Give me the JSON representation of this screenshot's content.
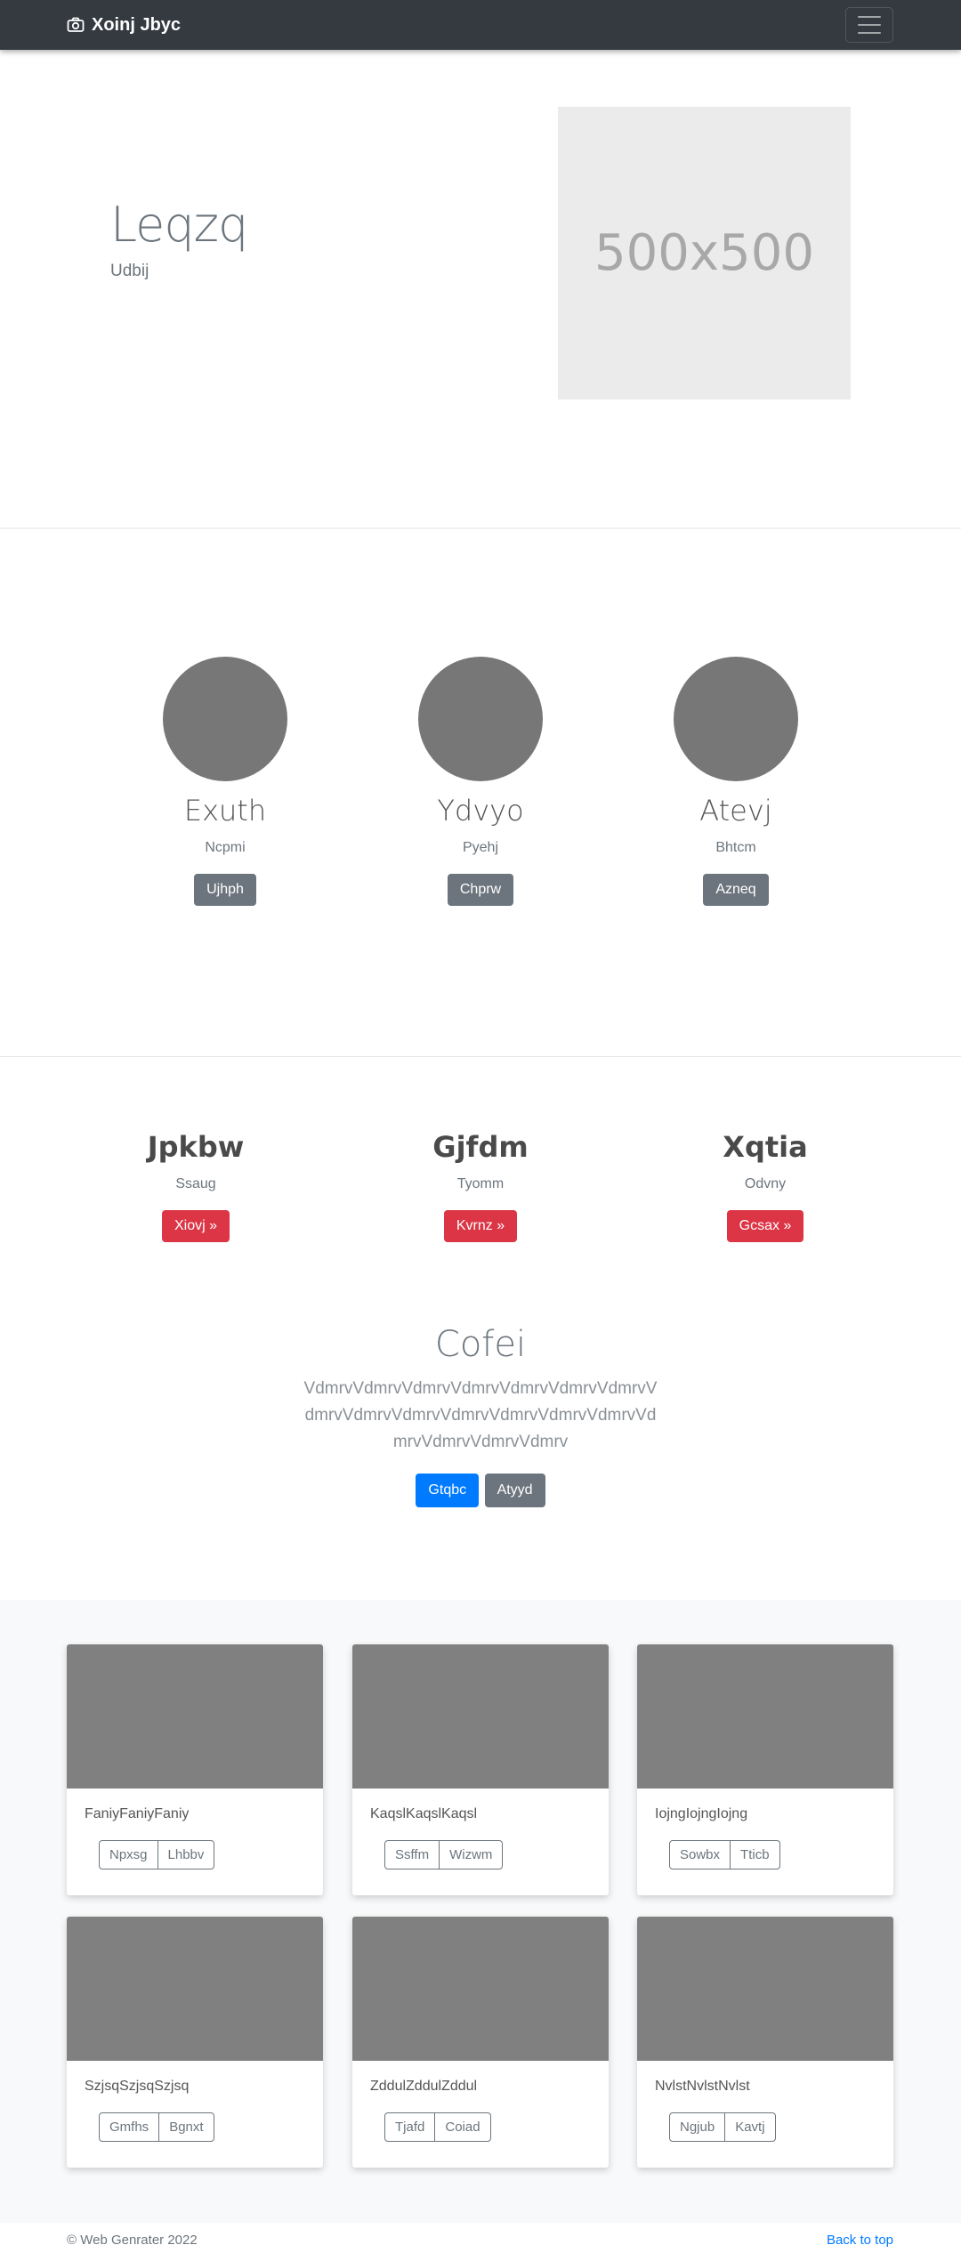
{
  "navbar": {
    "brand": "Xoinj Jbyc",
    "brand_icon": "camera-icon",
    "menu_icon": "hamburger-icon"
  },
  "hero": {
    "title": "Leqzq",
    "subtitle": "Udbij",
    "image_label": "500x500"
  },
  "circles": [
    {
      "name": "Exuth",
      "desc": "Ncpmi",
      "button": "Ujhph"
    },
    {
      "name": "Ydvyo",
      "desc": "Pyehj",
      "button": "Chprw"
    },
    {
      "name": "Atevj",
      "desc": "Bhtcm",
      "button": "Azneq"
    }
  ],
  "features": [
    {
      "title": "Jpkbw",
      "desc": "Ssaug",
      "button": "Xiovj »"
    },
    {
      "title": "Gjfdm",
      "desc": "Tyomm",
      "button": "Kvrnz »"
    },
    {
      "title": "Xqtia",
      "desc": "Odvny",
      "button": "Gcsax »"
    }
  ],
  "jumbotron": {
    "title": "Cofei",
    "text": "VdmrvVdmrvVdmrvVdmrvVdmrvVdmrvVdmrvVdmrvVdmrvVdmrvVdmrvVdmrvVdmrvVdmrvVdmrvVdmrvVdmrvVdmrv",
    "primary_button": "Gtqbc",
    "secondary_button": "Atyyd"
  },
  "cards": [
    {
      "text": "FaniyFaniyFaniy",
      "btn1": "Npxsg",
      "btn2": "Lhbbv"
    },
    {
      "text": "KaqslKaqslKaqsl",
      "btn1": "Ssffm",
      "btn2": "Wizwm"
    },
    {
      "text": "IojngIojngIojng",
      "btn1": "Sowbx",
      "btn2": "Tticb"
    },
    {
      "text": "SzjsqSzjsqSzjsq",
      "btn1": "Gmfhs",
      "btn2": "Bgnxt"
    },
    {
      "text": "ZddulZddulZddul",
      "btn1": "Tjafd",
      "btn2": "Coiad"
    },
    {
      "text": "NvlstNvlstNvlst",
      "btn1": "Ngjub",
      "btn2": "Kavtj"
    }
  ],
  "footer": {
    "copyright": "© Web Genrater 2022",
    "back_to_top": "Back to top"
  },
  "colors": {
    "navbar": "#343a40",
    "primary": "#007bff",
    "danger": "#dc3545",
    "secondary": "#6c757d"
  }
}
